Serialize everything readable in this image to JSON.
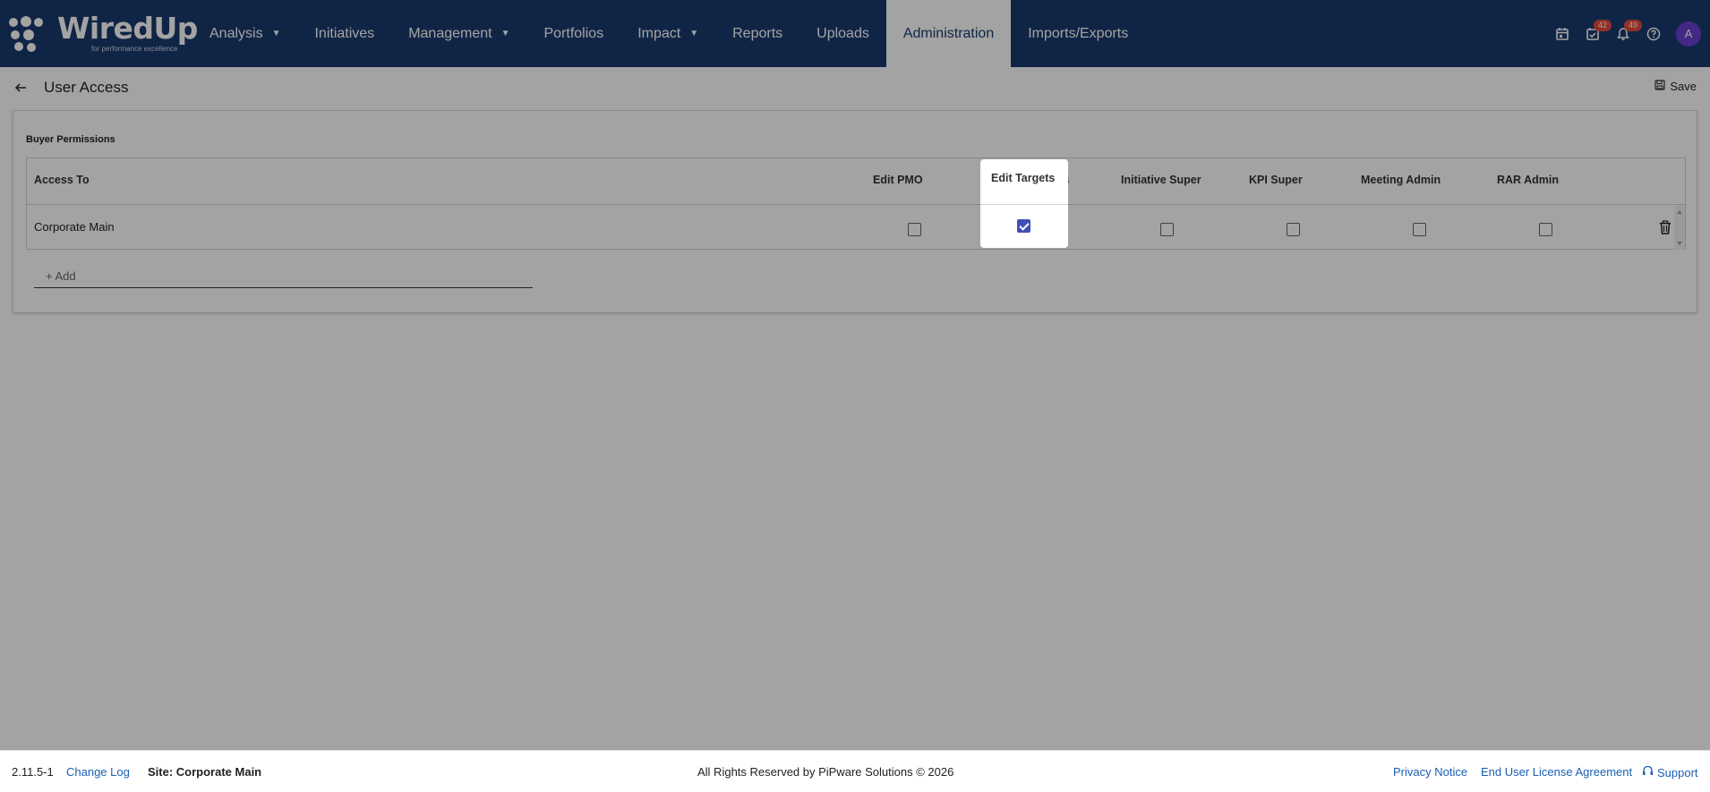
{
  "app": {
    "logo_text": "WiredUp",
    "logo_tagline": "for performance excellence"
  },
  "nav": {
    "items": [
      {
        "label": "Analysis",
        "dropdown": true
      },
      {
        "label": "Initiatives",
        "dropdown": false
      },
      {
        "label": "Management",
        "dropdown": true
      },
      {
        "label": "Portfolios",
        "dropdown": false
      },
      {
        "label": "Impact",
        "dropdown": true
      },
      {
        "label": "Reports",
        "dropdown": false
      },
      {
        "label": "Uploads",
        "dropdown": false
      },
      {
        "label": "Administration",
        "dropdown": false,
        "active": true
      },
      {
        "label": "Imports/Exports",
        "dropdown": false
      }
    ],
    "icons": {
      "calendar": "calendar-icon",
      "tasks": "task-check-icon",
      "tasks_badge": "42",
      "notifications": "bell-icon",
      "notifications_badge": "49",
      "help": "help-icon",
      "avatar_initial": "A"
    }
  },
  "page": {
    "title": "User Access",
    "save_label": "Save"
  },
  "card": {
    "title": "Buyer Permissions",
    "columns": [
      "Access To",
      "Edit PMO",
      "Edit Targets",
      "Initiative Super",
      "KPI Super",
      "Meeting Admin",
      "RAR Admin"
    ],
    "rows": [
      {
        "access_to": "Corporate Main",
        "edit_pmo": false,
        "edit_targets": true,
        "initiative_super": false,
        "kpi_super": false,
        "meeting_admin": false,
        "rar_admin": false
      }
    ],
    "add_label": "+ Add"
  },
  "footer": {
    "version": "2.11.5-1",
    "change_log": "Change Log",
    "site": "Site: Corporate Main",
    "rights": "All Rights Reserved by PiPware Solutions © 2026",
    "privacy": "Privacy Notice",
    "eula": "End User License Agreement",
    "support": "Support"
  },
  "colors": {
    "nav_bg": "#1a3a6e",
    "accent_checkbox": "#3f51b5",
    "link": "#1a5fb4",
    "badge": "#e64a3b",
    "avatar": "#6a3fd0"
  }
}
